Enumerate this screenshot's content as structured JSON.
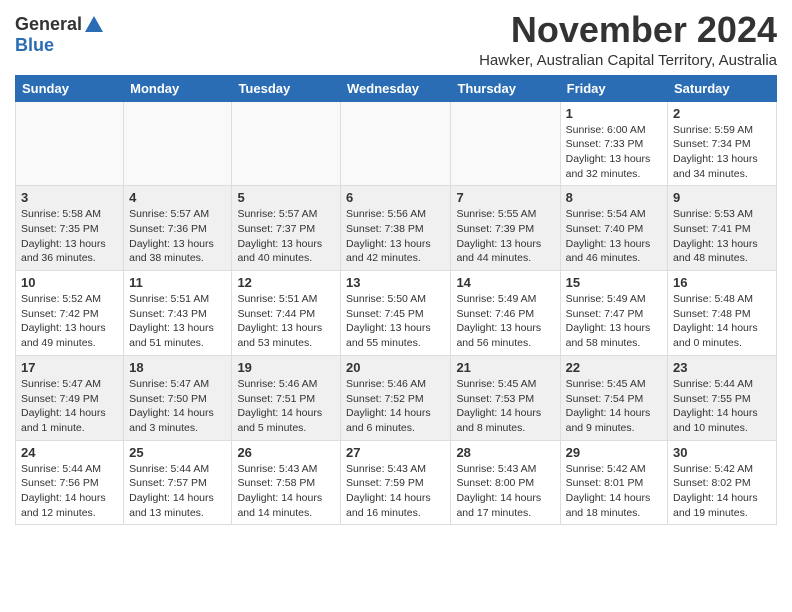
{
  "header": {
    "logo_general": "General",
    "logo_blue": "Blue",
    "month_title": "November 2024",
    "location": "Hawker, Australian Capital Territory, Australia"
  },
  "calendar": {
    "days_of_week": [
      "Sunday",
      "Monday",
      "Tuesday",
      "Wednesday",
      "Thursday",
      "Friday",
      "Saturday"
    ],
    "weeks": [
      [
        {
          "day": "",
          "info": ""
        },
        {
          "day": "",
          "info": ""
        },
        {
          "day": "",
          "info": ""
        },
        {
          "day": "",
          "info": ""
        },
        {
          "day": "",
          "info": ""
        },
        {
          "day": "1",
          "info": "Sunrise: 6:00 AM\nSunset: 7:33 PM\nDaylight: 13 hours\nand 32 minutes."
        },
        {
          "day": "2",
          "info": "Sunrise: 5:59 AM\nSunset: 7:34 PM\nDaylight: 13 hours\nand 34 minutes."
        }
      ],
      [
        {
          "day": "3",
          "info": "Sunrise: 5:58 AM\nSunset: 7:35 PM\nDaylight: 13 hours\nand 36 minutes."
        },
        {
          "day": "4",
          "info": "Sunrise: 5:57 AM\nSunset: 7:36 PM\nDaylight: 13 hours\nand 38 minutes."
        },
        {
          "day": "5",
          "info": "Sunrise: 5:57 AM\nSunset: 7:37 PM\nDaylight: 13 hours\nand 40 minutes."
        },
        {
          "day": "6",
          "info": "Sunrise: 5:56 AM\nSunset: 7:38 PM\nDaylight: 13 hours\nand 42 minutes."
        },
        {
          "day": "7",
          "info": "Sunrise: 5:55 AM\nSunset: 7:39 PM\nDaylight: 13 hours\nand 44 minutes."
        },
        {
          "day": "8",
          "info": "Sunrise: 5:54 AM\nSunset: 7:40 PM\nDaylight: 13 hours\nand 46 minutes."
        },
        {
          "day": "9",
          "info": "Sunrise: 5:53 AM\nSunset: 7:41 PM\nDaylight: 13 hours\nand 48 minutes."
        }
      ],
      [
        {
          "day": "10",
          "info": "Sunrise: 5:52 AM\nSunset: 7:42 PM\nDaylight: 13 hours\nand 49 minutes."
        },
        {
          "day": "11",
          "info": "Sunrise: 5:51 AM\nSunset: 7:43 PM\nDaylight: 13 hours\nand 51 minutes."
        },
        {
          "day": "12",
          "info": "Sunrise: 5:51 AM\nSunset: 7:44 PM\nDaylight: 13 hours\nand 53 minutes."
        },
        {
          "day": "13",
          "info": "Sunrise: 5:50 AM\nSunset: 7:45 PM\nDaylight: 13 hours\nand 55 minutes."
        },
        {
          "day": "14",
          "info": "Sunrise: 5:49 AM\nSunset: 7:46 PM\nDaylight: 13 hours\nand 56 minutes."
        },
        {
          "day": "15",
          "info": "Sunrise: 5:49 AM\nSunset: 7:47 PM\nDaylight: 13 hours\nand 58 minutes."
        },
        {
          "day": "16",
          "info": "Sunrise: 5:48 AM\nSunset: 7:48 PM\nDaylight: 14 hours\nand 0 minutes."
        }
      ],
      [
        {
          "day": "17",
          "info": "Sunrise: 5:47 AM\nSunset: 7:49 PM\nDaylight: 14 hours\nand 1 minute."
        },
        {
          "day": "18",
          "info": "Sunrise: 5:47 AM\nSunset: 7:50 PM\nDaylight: 14 hours\nand 3 minutes."
        },
        {
          "day": "19",
          "info": "Sunrise: 5:46 AM\nSunset: 7:51 PM\nDaylight: 14 hours\nand 5 minutes."
        },
        {
          "day": "20",
          "info": "Sunrise: 5:46 AM\nSunset: 7:52 PM\nDaylight: 14 hours\nand 6 minutes."
        },
        {
          "day": "21",
          "info": "Sunrise: 5:45 AM\nSunset: 7:53 PM\nDaylight: 14 hours\nand 8 minutes."
        },
        {
          "day": "22",
          "info": "Sunrise: 5:45 AM\nSunset: 7:54 PM\nDaylight: 14 hours\nand 9 minutes."
        },
        {
          "day": "23",
          "info": "Sunrise: 5:44 AM\nSunset: 7:55 PM\nDaylight: 14 hours\nand 10 minutes."
        }
      ],
      [
        {
          "day": "24",
          "info": "Sunrise: 5:44 AM\nSunset: 7:56 PM\nDaylight: 14 hours\nand 12 minutes."
        },
        {
          "day": "25",
          "info": "Sunrise: 5:44 AM\nSunset: 7:57 PM\nDaylight: 14 hours\nand 13 minutes."
        },
        {
          "day": "26",
          "info": "Sunrise: 5:43 AM\nSunset: 7:58 PM\nDaylight: 14 hours\nand 14 minutes."
        },
        {
          "day": "27",
          "info": "Sunrise: 5:43 AM\nSunset: 7:59 PM\nDaylight: 14 hours\nand 16 minutes."
        },
        {
          "day": "28",
          "info": "Sunrise: 5:43 AM\nSunset: 8:00 PM\nDaylight: 14 hours\nand 17 minutes."
        },
        {
          "day": "29",
          "info": "Sunrise: 5:42 AM\nSunset: 8:01 PM\nDaylight: 14 hours\nand 18 minutes."
        },
        {
          "day": "30",
          "info": "Sunrise: 5:42 AM\nSunset: 8:02 PM\nDaylight: 14 hours\nand 19 minutes."
        }
      ]
    ]
  }
}
